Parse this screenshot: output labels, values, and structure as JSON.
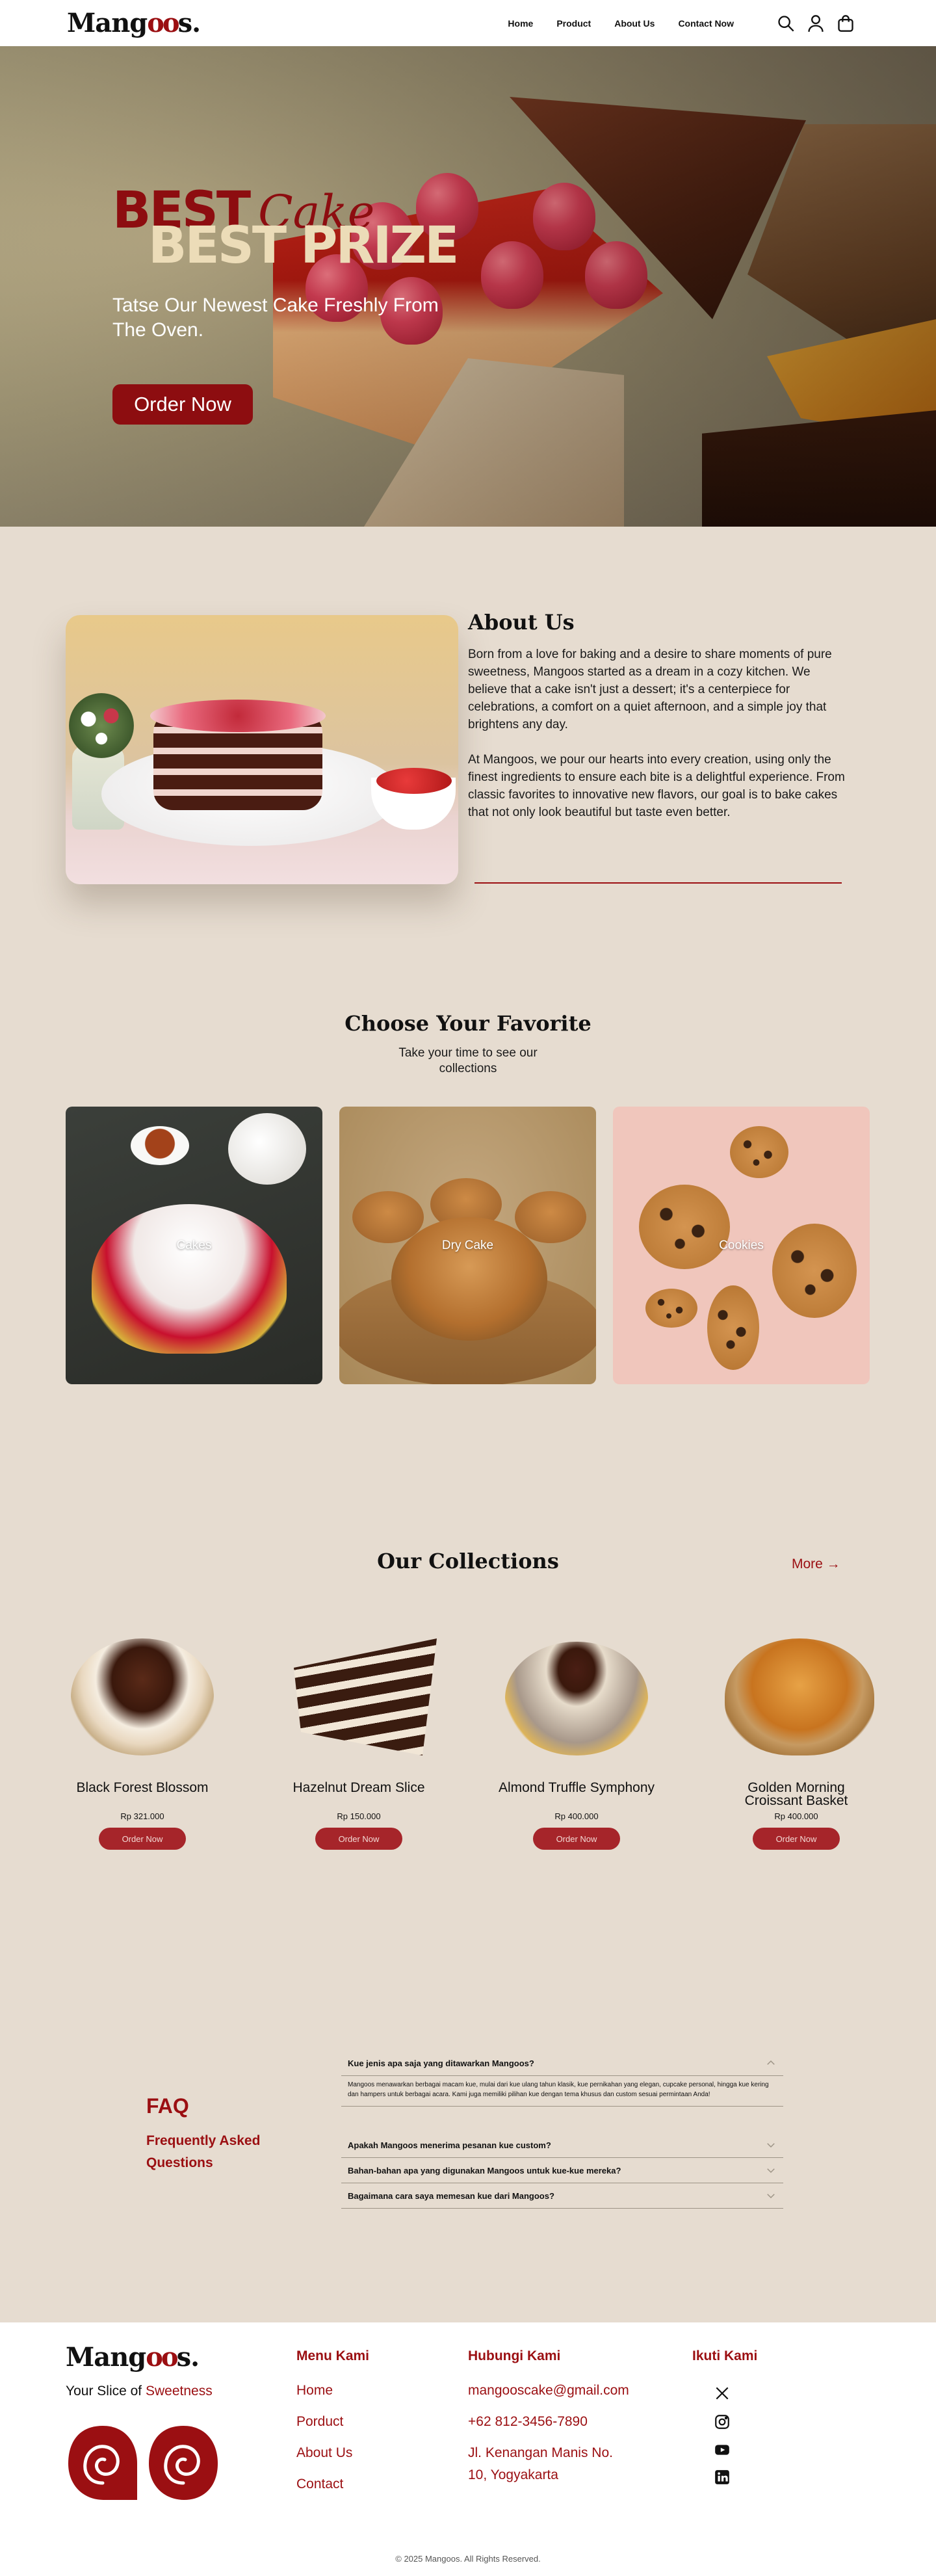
{
  "brand": {
    "name_start": "Mang",
    "name_oo": "oo",
    "name_end": "s."
  },
  "nav": {
    "links": [
      "Home",
      "Product",
      "About Us",
      "Contact Now"
    ],
    "icons": [
      "search-icon",
      "user-icon",
      "shopping-bag-icon"
    ]
  },
  "hero": {
    "title_best": "BEST",
    "title_cake": "Cake",
    "title_prize": "BEST PRIZE",
    "subtitle": "Tatse Our Newest Cake Freshly From The Oven.",
    "cta": "Order Now"
  },
  "about": {
    "title": "About Us",
    "paragraph_1": "Born from a love for baking and a desire to share moments of pure sweetness, Mangoos started as a dream in a cozy kitchen. We believe that a cake isn't just a dessert; it's a centerpiece for celebrations, a comfort on a quiet afternoon, and a simple joy that brightens any day.",
    "paragraph_2": "At Mangoos, we pour our hearts into every creation, using only the finest ingredients to ensure each bite is a delightful experience. From classic favorites to innovative new flavors, our goal is to bake cakes that not only look beautiful but taste even better."
  },
  "favorites": {
    "title": "Choose Your Favorite",
    "subtitle": "Take your time to see our collections",
    "cards": [
      "Cakes",
      "Dry Cake",
      "Cookies"
    ]
  },
  "collections": {
    "title": "Our Collections",
    "more": "More →",
    "products": [
      {
        "name": "Black Forest Blossom",
        "price": "Rp 321.000",
        "cta": "Order Now"
      },
      {
        "name": "Hazelnut Dream Slice",
        "price": "Rp 150.000",
        "cta": "Order Now"
      },
      {
        "name": "Almond Truffle Symphony",
        "price": "Rp 400.000",
        "cta": "Order Now"
      },
      {
        "name": "Golden Morning Croissant Basket",
        "price": "Rp 400.000",
        "cta": "Order Now"
      }
    ]
  },
  "faq": {
    "title": "FAQ",
    "subtitle": "Frequently Asked Questions",
    "items": [
      {
        "question": "Kue jenis apa saja yang ditawarkan Mangoos?",
        "answer": "Mangoos menawarkan berbagai macam kue, mulai dari kue ulang tahun klasik, kue pernikahan yang elegan, cupcake personal, hingga kue kering dan hampers untuk berbagai acara. Kami juga memiliki pilihan kue dengan tema khusus dan custom sesuai permintaan Anda!",
        "open": true
      },
      {
        "question": "Apakah Mangoos menerima pesanan kue custom?",
        "open": false
      },
      {
        "question": "Bahan-bahan apa yang digunakan Mangoos untuk kue-kue mereka?",
        "open": false
      },
      {
        "question": "Bagaimana cara saya memesan kue dari Mangoos?",
        "open": false
      }
    ]
  },
  "footer": {
    "tagline_start": "Your Slice of ",
    "tagline_highlight": "Sweetness",
    "menu_title": "Menu Kami",
    "menu_links": [
      "Home",
      "Porduct",
      "About Us",
      "Contact"
    ],
    "contact_title": "Hubungi Kami",
    "email": "mangooscake@gmail.com",
    "phone": "+62 812-3456-7890",
    "address_line_1": "Jl. Kenangan Manis No.",
    "address_line_2": "10, Yogyakarta",
    "social_title": "Ikuti Kami",
    "social_icons": [
      "x-icon",
      "instagram-icon",
      "youtube-icon",
      "linkedin-icon"
    ],
    "copyright": "© 2025 Mangoos. All Rights Reserved."
  },
  "colors": {
    "brand_red": "#9b0f12",
    "page_bg": "#e6dcd0",
    "hero_cream": "#ecdcb8"
  }
}
